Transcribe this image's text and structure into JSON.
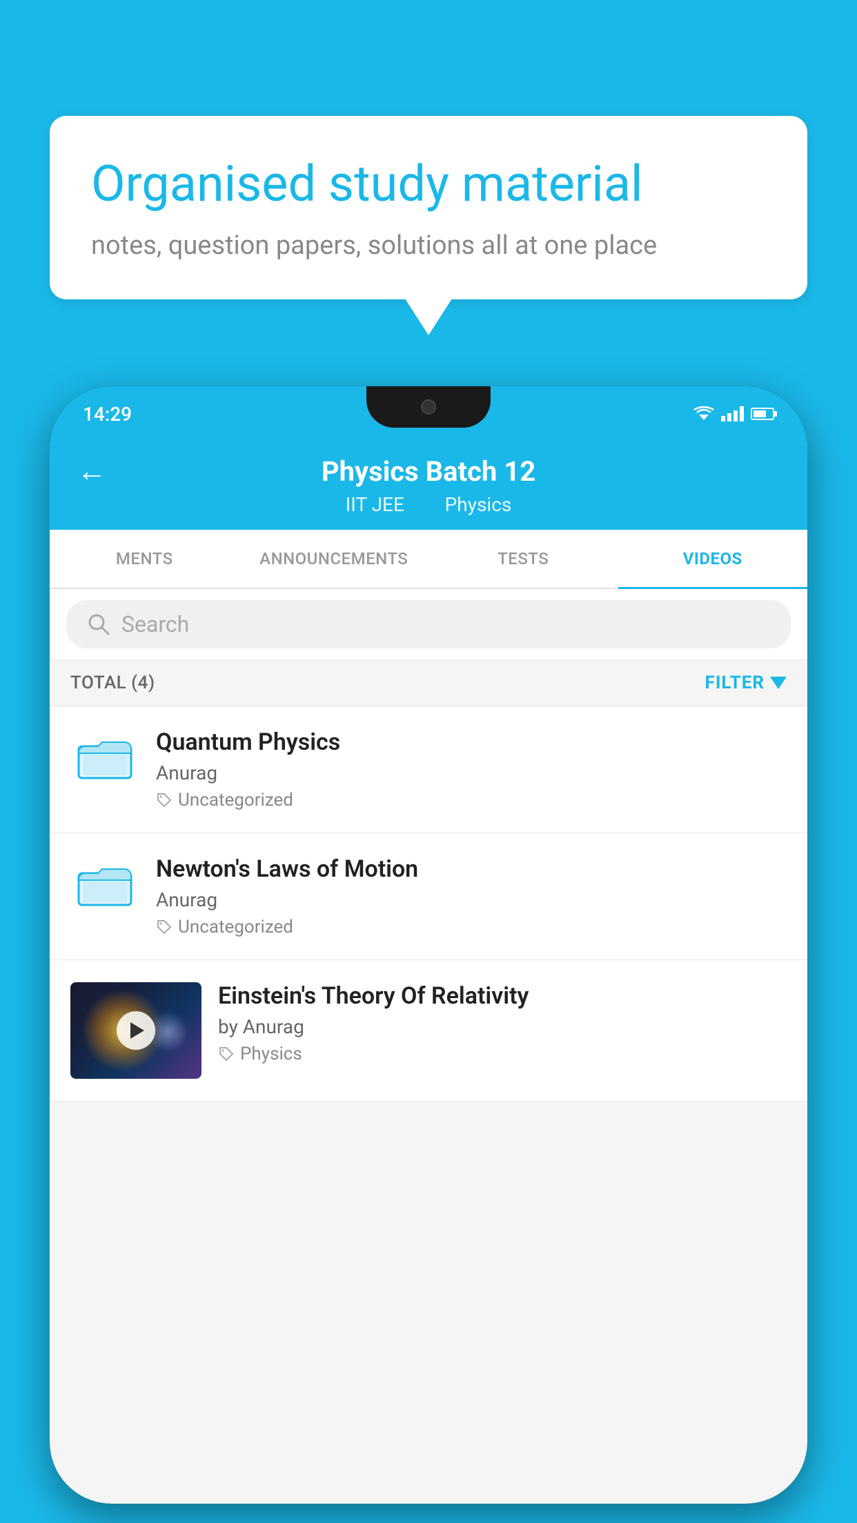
{
  "background_color": "#1ab8e8",
  "speech_bubble": {
    "title": "Organised study material",
    "subtitle": "notes, question papers, solutions all at one place"
  },
  "phone": {
    "status_bar": {
      "time": "14:29"
    },
    "app_header": {
      "back_label": "←",
      "title": "Physics Batch 12",
      "subtitle_part1": "IIT JEE",
      "subtitle_part2": "Physics"
    },
    "tabs": [
      {
        "label": "MENTS",
        "active": false
      },
      {
        "label": "ANNOUNCEMENTS",
        "active": false
      },
      {
        "label": "TESTS",
        "active": false
      },
      {
        "label": "VIDEOS",
        "active": true
      }
    ],
    "search": {
      "placeholder": "Search"
    },
    "filter_row": {
      "total_label": "TOTAL (4)",
      "filter_label": "FILTER"
    },
    "videos": [
      {
        "id": 1,
        "title": "Quantum Physics",
        "author": "Anurag",
        "tag": "Uncategorized",
        "has_thumbnail": false
      },
      {
        "id": 2,
        "title": "Newton's Laws of Motion",
        "author": "Anurag",
        "tag": "Uncategorized",
        "has_thumbnail": false
      },
      {
        "id": 3,
        "title": "Einstein's Theory Of Relativity",
        "author": "by Anurag",
        "tag": "Physics",
        "has_thumbnail": true
      }
    ]
  }
}
